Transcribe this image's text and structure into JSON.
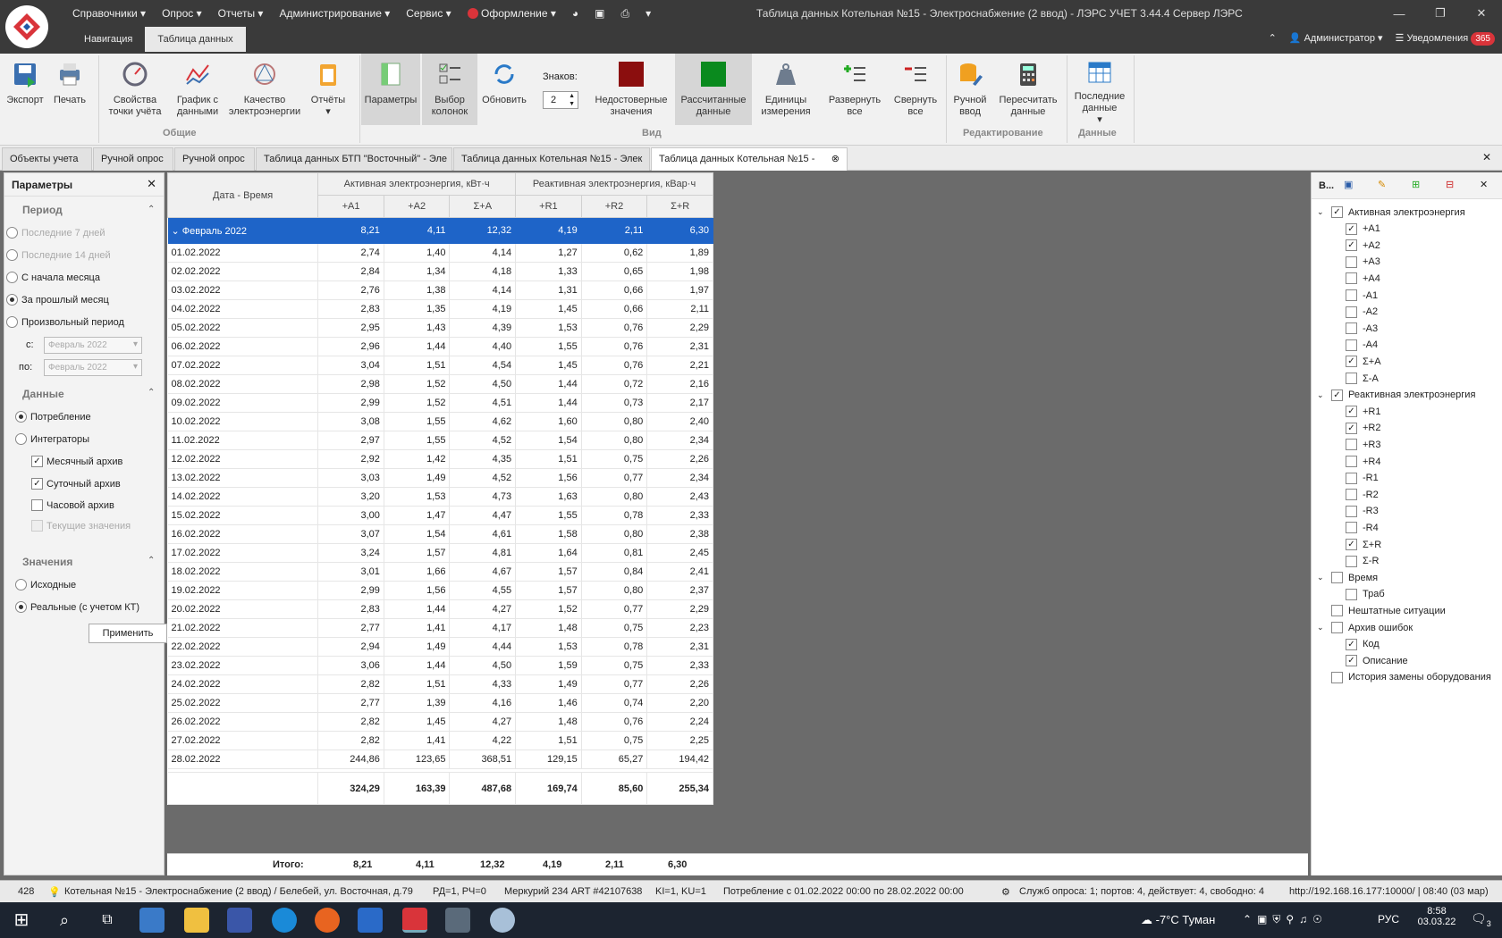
{
  "menu": [
    "Справочники",
    "Опрос",
    "Отчеты",
    "Администрирование",
    "Сервис",
    "Оформление"
  ],
  "window_title": "Таблица данных Котельная №15 - Электроснабжение (2 ввод) - ЛЭРС УЧЕТ 3.44.4 Сервер ЛЭРС",
  "nav_tabs": [
    "Навигация",
    "Таблица данных"
  ],
  "user": "Администратор",
  "notifications_label": "Уведомления",
  "notifications_count": "365",
  "ribbon": {
    "buttons": [
      "Экспорт",
      "Печать",
      "Свойства точки учёта",
      "График с данными",
      "Качество электроэнергии",
      "Отчёты",
      "Параметры",
      "Выбор колонок",
      "Обновить",
      "Недостоверные значения",
      "Рассчитанные данные",
      "Единицы измерения",
      "Развернуть все",
      "Свернуть все",
      "Ручной ввод",
      "Пересчитать данные",
      "Последние данные"
    ],
    "digits_label": "Знаков:",
    "digits_value": "2",
    "groups": [
      "Общие",
      "Вид",
      "Редактирование",
      "Данные"
    ]
  },
  "doc_tabs": [
    "Объекты учета",
    "Ручной опрос",
    "Ручной опрос",
    "Таблица данных БТП \"Восточный\" - Эле",
    "Таблица данных Котельная №15 - Элек",
    "Таблица данных Котельная №15 -"
  ],
  "left": {
    "title": "Параметры",
    "period_title": "Период",
    "period_opts": [
      "Последние 7 дней",
      "Последние 14 дней",
      "С начала месяца",
      "За прошлый месяц",
      "Произвольный период"
    ],
    "from_label": "с:",
    "to_label": "по:",
    "from_value": "Февраль 2022",
    "to_value": "Февраль 2022",
    "data_title": "Данные",
    "data_opts": [
      "Потребление",
      "Интеграторы"
    ],
    "archives": [
      "Месячный архив",
      "Суточный архив",
      "Часовой архив",
      "Текущие значения"
    ],
    "values_title": "Значения",
    "values_opts": [
      "Исходные",
      "Реальные (с учетом КТ)"
    ],
    "apply": "Применить"
  },
  "table": {
    "date_header": "Дата - Время",
    "active_header": "Активная электроэнергия, кВт·ч",
    "reactive_header": "Реактивная электроэнергия, кВар·ч",
    "cols": [
      "+A1",
      "+A2",
      "Σ+A",
      "+R1",
      "+R2",
      "Σ+R"
    ],
    "group": {
      "label": "Февраль 2022",
      "values": [
        "8,21",
        "4,11",
        "12,32",
        "4,19",
        "2,11",
        "6,30"
      ]
    },
    "rows": [
      [
        "01.02.2022",
        "2,74",
        "1,40",
        "4,14",
        "1,27",
        "0,62",
        "1,89"
      ],
      [
        "02.02.2022",
        "2,84",
        "1,34",
        "4,18",
        "1,33",
        "0,65",
        "1,98"
      ],
      [
        "03.02.2022",
        "2,76",
        "1,38",
        "4,14",
        "1,31",
        "0,66",
        "1,97"
      ],
      [
        "04.02.2022",
        "2,83",
        "1,35",
        "4,19",
        "1,45",
        "0,66",
        "2,11"
      ],
      [
        "05.02.2022",
        "2,95",
        "1,43",
        "4,39",
        "1,53",
        "0,76",
        "2,29"
      ],
      [
        "06.02.2022",
        "2,96",
        "1,44",
        "4,40",
        "1,55",
        "0,76",
        "2,31"
      ],
      [
        "07.02.2022",
        "3,04",
        "1,51",
        "4,54",
        "1,45",
        "0,76",
        "2,21"
      ],
      [
        "08.02.2022",
        "2,98",
        "1,52",
        "4,50",
        "1,44",
        "0,72",
        "2,16"
      ],
      [
        "09.02.2022",
        "2,99",
        "1,52",
        "4,51",
        "1,44",
        "0,73",
        "2,17"
      ],
      [
        "10.02.2022",
        "3,08",
        "1,55",
        "4,62",
        "1,60",
        "0,80",
        "2,40"
      ],
      [
        "11.02.2022",
        "2,97",
        "1,55",
        "4,52",
        "1,54",
        "0,80",
        "2,34"
      ],
      [
        "12.02.2022",
        "2,92",
        "1,42",
        "4,35",
        "1,51",
        "0,75",
        "2,26"
      ],
      [
        "13.02.2022",
        "3,03",
        "1,49",
        "4,52",
        "1,56",
        "0,77",
        "2,34"
      ],
      [
        "14.02.2022",
        "3,20",
        "1,53",
        "4,73",
        "1,63",
        "0,80",
        "2,43"
      ],
      [
        "15.02.2022",
        "3,00",
        "1,47",
        "4,47",
        "1,55",
        "0,78",
        "2,33"
      ],
      [
        "16.02.2022",
        "3,07",
        "1,54",
        "4,61",
        "1,58",
        "0,80",
        "2,38"
      ],
      [
        "17.02.2022",
        "3,24",
        "1,57",
        "4,81",
        "1,64",
        "0,81",
        "2,45"
      ],
      [
        "18.02.2022",
        "3,01",
        "1,66",
        "4,67",
        "1,57",
        "0,84",
        "2,41"
      ],
      [
        "19.02.2022",
        "2,99",
        "1,56",
        "4,55",
        "1,57",
        "0,80",
        "2,37"
      ],
      [
        "20.02.2022",
        "2,83",
        "1,44",
        "4,27",
        "1,52",
        "0,77",
        "2,29"
      ],
      [
        "21.02.2022",
        "2,77",
        "1,41",
        "4,17",
        "1,48",
        "0,75",
        "2,23"
      ],
      [
        "22.02.2022",
        "2,94",
        "1,49",
        "4,44",
        "1,53",
        "0,78",
        "2,31"
      ],
      [
        "23.02.2022",
        "3,06",
        "1,44",
        "4,50",
        "1,59",
        "0,75",
        "2,33"
      ],
      [
        "24.02.2022",
        "2,82",
        "1,51",
        "4,33",
        "1,49",
        "0,77",
        "2,26"
      ],
      [
        "25.02.2022",
        "2,77",
        "1,39",
        "4,16",
        "1,46",
        "0,74",
        "2,20"
      ],
      [
        "26.02.2022",
        "2,82",
        "1,45",
        "4,27",
        "1,48",
        "0,76",
        "2,24"
      ],
      [
        "27.02.2022",
        "2,82",
        "1,41",
        "4,22",
        "1,51",
        "0,75",
        "2,25"
      ],
      [
        "28.02.2022",
        "244,86",
        "123,65",
        "368,51",
        "129,15",
        "65,27",
        "194,42"
      ]
    ],
    "total": [
      "324,29",
      "163,39",
      "487,68",
      "169,74",
      "85,60",
      "255,34"
    ],
    "footer_label": "Итого:",
    "footer": [
      "8,21",
      "4,11",
      "12,32",
      "4,19",
      "2,11",
      "6,30"
    ]
  },
  "right": {
    "title": "В...",
    "items": [
      {
        "label": "Активная электроэнергия",
        "checked": true,
        "level": 0,
        "expand": true
      },
      {
        "label": "+A1",
        "checked": true,
        "level": 1
      },
      {
        "label": "+A2",
        "checked": true,
        "level": 1
      },
      {
        "label": "+A3",
        "checked": false,
        "level": 1
      },
      {
        "label": "+A4",
        "checked": false,
        "level": 1
      },
      {
        "label": "-A1",
        "checked": false,
        "level": 1
      },
      {
        "label": "-A2",
        "checked": false,
        "level": 1
      },
      {
        "label": "-A3",
        "checked": false,
        "level": 1
      },
      {
        "label": "-A4",
        "checked": false,
        "level": 1
      },
      {
        "label": "Σ+A",
        "checked": true,
        "level": 1
      },
      {
        "label": "Σ-A",
        "checked": false,
        "level": 1
      },
      {
        "label": "Реактивная электроэнергия",
        "checked": true,
        "level": 0,
        "expand": true
      },
      {
        "label": "+R1",
        "checked": true,
        "level": 1
      },
      {
        "label": "+R2",
        "checked": true,
        "level": 1
      },
      {
        "label": "+R3",
        "checked": false,
        "level": 1
      },
      {
        "label": "+R4",
        "checked": false,
        "level": 1
      },
      {
        "label": "-R1",
        "checked": false,
        "level": 1
      },
      {
        "label": "-R2",
        "checked": false,
        "level": 1
      },
      {
        "label": "-R3",
        "checked": false,
        "level": 1
      },
      {
        "label": "-R4",
        "checked": false,
        "level": 1
      },
      {
        "label": "Σ+R",
        "checked": true,
        "level": 1
      },
      {
        "label": "Σ-R",
        "checked": false,
        "level": 1
      },
      {
        "label": "Время",
        "checked": false,
        "level": 0,
        "expand": true
      },
      {
        "label": "Траб",
        "checked": false,
        "level": 1
      },
      {
        "label": "Нештатные ситуации",
        "checked": false,
        "level": 0
      },
      {
        "label": "Архив ошибок",
        "checked": false,
        "level": 0,
        "expand": true
      },
      {
        "label": "Код",
        "checked": true,
        "level": 1
      },
      {
        "label": "Описание",
        "checked": true,
        "level": 1
      },
      {
        "label": "История замены оборудования",
        "checked": false,
        "level": 0
      }
    ]
  },
  "status": {
    "id": "428",
    "object": "Котельная №15 - Электроснабжение (2 ввод) / Белебей, ул. Восточная, д.79",
    "rd": "РД=1, РЧ=0",
    "device": "Меркурий 234 ART #42107638",
    "k": "KI=1, KU=1",
    "period": "Потребление с 01.02.2022 00:00 по 28.02.2022 00:00",
    "services": "Служб опроса: 1; портов: 4, действует: 4, свободно: 4",
    "server": "http://192.168.16.177:10000/ | 08:40 (03 мар)"
  },
  "taskbar": {
    "weather": "-7°C Туман",
    "lang": "РУС",
    "time": "8:58",
    "date": "03.03.22",
    "notif": "3"
  },
  "colors": {
    "selection": "#1e64c8",
    "red_square": "#8b0e0e",
    "green_square": "#0a8a1e",
    "badge": "#d9343a"
  }
}
